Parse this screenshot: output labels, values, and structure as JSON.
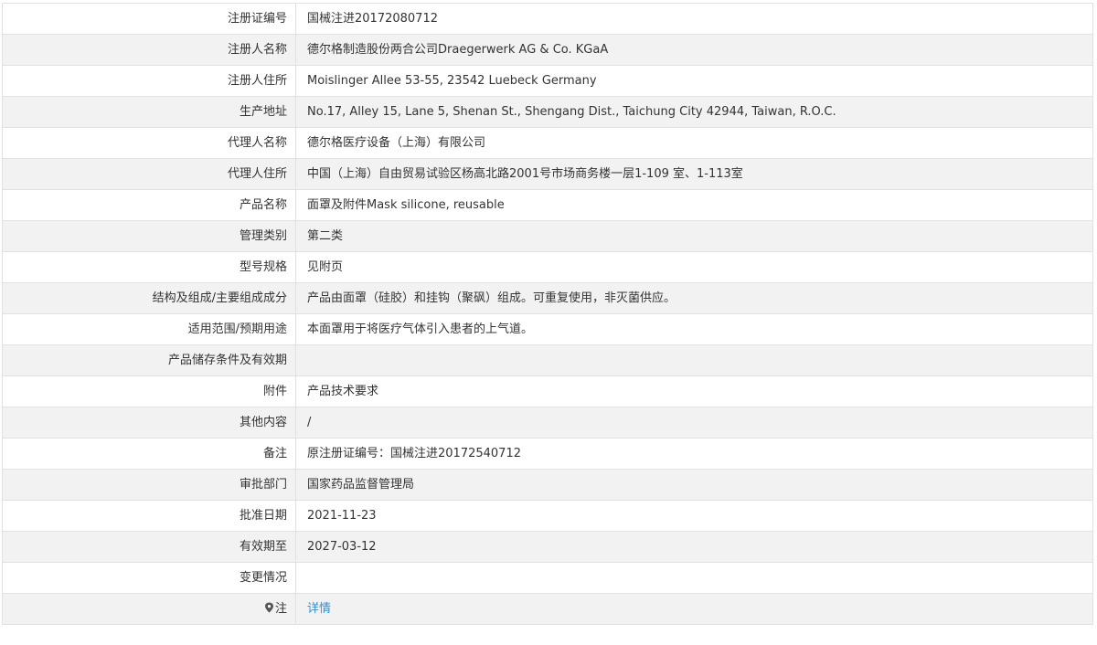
{
  "rows": [
    {
      "label": "注册证编号",
      "value": "国械注进20172080712"
    },
    {
      "label": "注册人名称",
      "value": "德尔格制造股份两合公司Draegerwerk AG & Co. KGaA"
    },
    {
      "label": "注册人住所",
      "value": "Moislinger Allee 53-55, 23542 Luebeck Germany"
    },
    {
      "label": "生产地址",
      "value": "No.17, Alley 15, Lane 5, Shenan St., Shengang Dist., Taichung City 42944, Taiwan, R.O.C."
    },
    {
      "label": "代理人名称",
      "value": "德尔格医疗设备（上海）有限公司"
    },
    {
      "label": "代理人住所",
      "value": "中国（上海）自由贸易试验区杨高北路2001号市场商务楼一层1-109 室、1-113室"
    },
    {
      "label": "产品名称",
      "value": "面罩及附件Mask silicone, reusable"
    },
    {
      "label": "管理类别",
      "value": "第二类"
    },
    {
      "label": "型号规格",
      "value": "见附页"
    },
    {
      "label": "结构及组成/主要组成成分",
      "value": "产品由面罩（硅胶）和挂钩（聚砜）组成。可重复使用，非灭菌供应。"
    },
    {
      "label": "适用范围/预期用途",
      "value": "本面罩用于将医疗气体引入患者的上气道。"
    },
    {
      "label": "产品储存条件及有效期",
      "value": ""
    },
    {
      "label": "附件",
      "value": "产品技术要求"
    },
    {
      "label": "其他内容",
      "value": "/"
    },
    {
      "label": "备注",
      "value": "原注册证编号：国械注进20172540712"
    },
    {
      "label": "审批部门",
      "value": "国家药品监督管理局"
    },
    {
      "label": "批准日期",
      "value": "2021-11-23"
    },
    {
      "label": "有效期至",
      "value": "2027-03-12"
    },
    {
      "label": "变更情况",
      "value": ""
    }
  ],
  "note": {
    "icon": "map-pin-icon",
    "label": "注",
    "link_text": "详情",
    "link_color": "#2e8ed8"
  }
}
